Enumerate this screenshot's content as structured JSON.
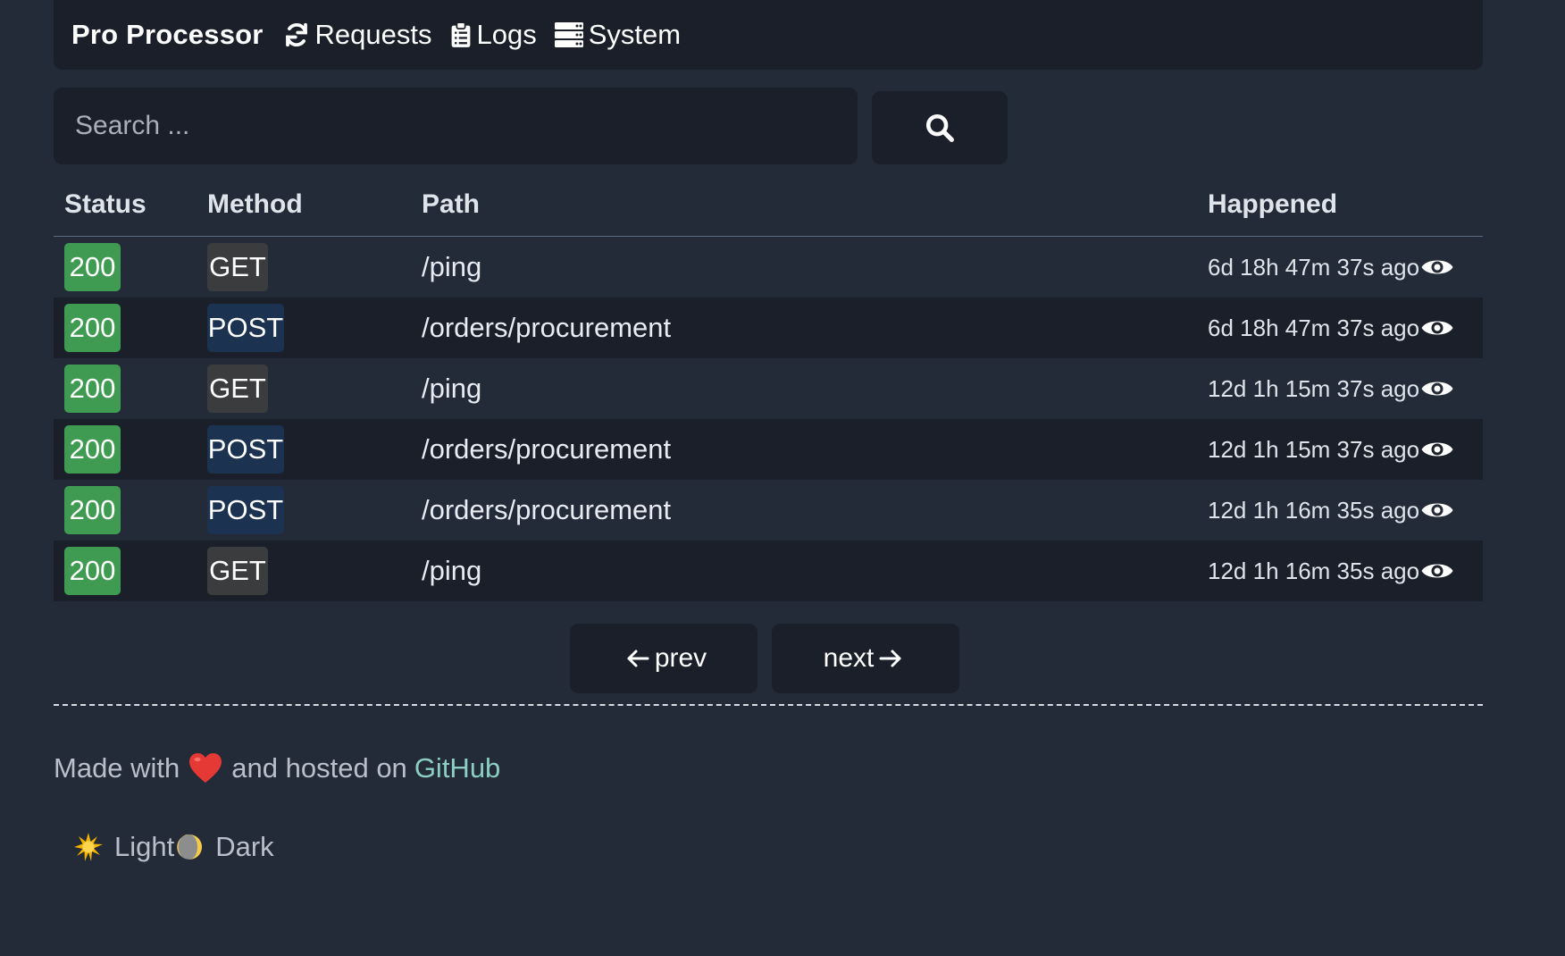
{
  "nav": {
    "brand": "Pro Processor",
    "links": [
      {
        "label": "Requests",
        "icon": "refresh-icon"
      },
      {
        "label": "Logs",
        "icon": "clipboard-icon"
      },
      {
        "label": "System",
        "icon": "server-icon"
      }
    ]
  },
  "search": {
    "placeholder": "Search ...",
    "icon": "search-icon"
  },
  "table": {
    "headers": {
      "status": "Status",
      "method": "Method",
      "path": "Path",
      "happened": "Happened"
    },
    "rows": [
      {
        "status": "200",
        "method": "GET",
        "path": "/ping",
        "happened": "6d 18h 47m 37s ago"
      },
      {
        "status": "200",
        "method": "POST",
        "path": "/orders/procurement",
        "happened": "6d 18h 47m 37s ago"
      },
      {
        "status": "200",
        "method": "GET",
        "path": "/ping",
        "happened": "12d 1h 15m 37s ago"
      },
      {
        "status": "200",
        "method": "POST",
        "path": "/orders/procurement",
        "happened": "12d 1h 15m 37s ago"
      },
      {
        "status": "200",
        "method": "POST",
        "path": "/orders/procurement",
        "happened": "12d 1h 16m 35s ago"
      },
      {
        "status": "200",
        "method": "GET",
        "path": "/ping",
        "happened": "12d 1h 16m 35s ago"
      }
    ]
  },
  "pagination": {
    "prev": "prev",
    "next": "next"
  },
  "footer": {
    "made_with": "Made with",
    "hosted_on": "and hosted on",
    "link": "GitHub",
    "theme_light": "Light",
    "theme_dark": "Dark"
  },
  "colors": {
    "background": "#232a38",
    "panel": "#1a1f29",
    "status_ok": "#3f9a52",
    "method_get": "#3b3c3e",
    "method_post": "#1b3350",
    "link": "#8ccfc2"
  }
}
